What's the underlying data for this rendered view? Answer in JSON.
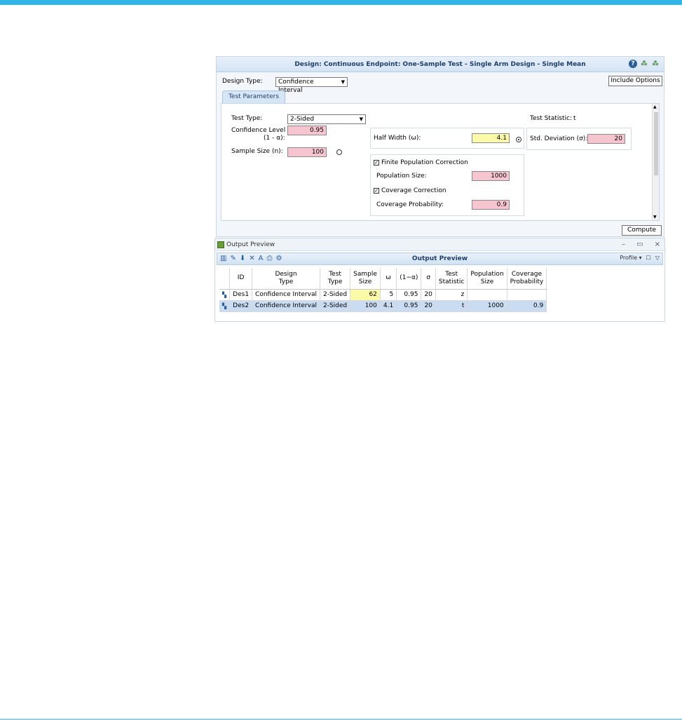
{
  "design_window": {
    "title": "Design: Continuous Endpoint: One-Sample Test - Single Arm Design - Single Mean",
    "design_type_label": "Design Type:",
    "design_type_value": "Confidence Interval",
    "include_options_label": "Include Options",
    "tab_label": "Test Parameters",
    "test_type_label": "Test Type:",
    "test_type_value": "2-Sided",
    "confidence_level_label": "Confidence Level",
    "confidence_level_sub": "(1 - α):",
    "confidence_level_value": "0.95",
    "sample_size_label": "Sample Size (n):",
    "sample_size_value": "100",
    "half_width_label": "Half Width (ω):",
    "half_width_value": "4.1",
    "test_statistic_label": "Test Statistic:",
    "test_statistic_value": "t",
    "std_dev_label": "Std. Deviation (σ):",
    "std_dev_value": "20",
    "fpc_label": "Finite Population Correction",
    "population_size_label": "Population Size:",
    "population_size_value": "1000",
    "coverage_correction_label": "Coverage Correction",
    "coverage_prob_label": "Coverage Probability:",
    "coverage_prob_value": "0.9",
    "compute_label": "Compute"
  },
  "output_window": {
    "window_title": "Output Preview",
    "toolbar_title": "Output Preview",
    "profile_label": "Profile",
    "columns": [
      "ID",
      "Design\nType",
      "Test\nType",
      "Sample\nSize",
      "ω",
      "(1−α)",
      "σ",
      "Test\nStatistic",
      "Population\nSize",
      "Coverage\nProbability"
    ],
    "rows": [
      [
        "Des1",
        "Confidence Interval",
        "2-Sided",
        "62",
        "5",
        "0.95",
        "20",
        "z",
        "",
        ""
      ],
      [
        "Des2",
        "Confidence Interval",
        "2-Sided",
        "100",
        "4.1",
        "0.95",
        "20",
        "t",
        "1000",
        "0.9"
      ]
    ]
  },
  "colors": {
    "accent": "#31b4e6",
    "input_pink": "#f7c5cf",
    "computed_yellow": "#fbfaa6",
    "selected_row": "#c9dcf2"
  }
}
